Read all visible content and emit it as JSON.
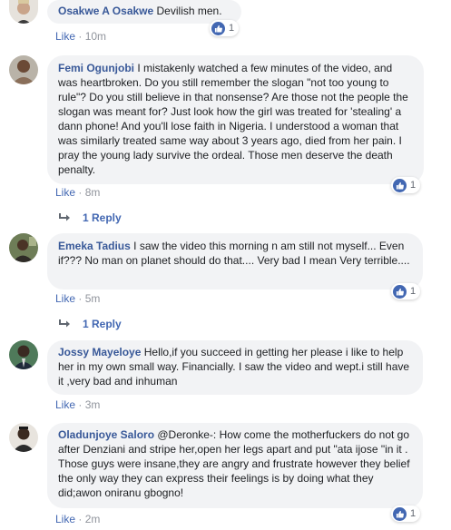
{
  "icons": {
    "like": "thumbs-up-icon",
    "reply": "reply-arrow-icon"
  },
  "colors": {
    "author": "#385898",
    "link": "#4267b2",
    "bubble": "#f2f3f5",
    "meta": "#90949c"
  },
  "comments": [
    {
      "author": "Osakwe A Osakwe",
      "text": "Devilish men.",
      "like_label": "Like",
      "sep": "·",
      "time": "10m",
      "reaction_count": "1"
    },
    {
      "author": "Femi Ogunjobi",
      "text": "I mistakenly watched a few minutes of the video, and was heartbroken. Do you still remember the slogan \"not too young to rule\"? Do you still believe in that nonsense? Are those not the people the slogan was meant for? Just look how the girl was treated for 'stealing' a dann phone! And you'll lose faith in Nigeria. I understood a woman that was similarly treated same way about 3 years ago, died from her pain. I pray the young lady survive the ordeal. Those men deserve the death penalty.",
      "like_label": "Like",
      "sep": "·",
      "time": "8m",
      "reaction_count": "1",
      "replies_label": "1 Reply"
    },
    {
      "author": "Emeka Tadius",
      "text": "I saw the video this morning n am still not myself... Even if??? No man on planet should do that.... Very bad I mean Very terrible....",
      "like_label": "Like",
      "sep": "·",
      "time": "5m",
      "reaction_count": "1",
      "replies_label": "1 Reply"
    },
    {
      "author": "Jossy Mayeloye",
      "text": "Hello,if you succeed in getting her please i like to help her in my own small way. Financially. I saw the video and wept.i still have it ,very bad and inhuman",
      "like_label": "Like",
      "sep": "·",
      "time": "3m"
    },
    {
      "author": "Oladunjoye Saloro",
      "text": "@Deronke-: How come the motherfuckers do not go after Denziani and stripe her,open her legs apart and put \"ata ijose \"in it . Those guys were insane,they are angry and frustrate however they belief the only way they can express their feelings is by doing what they did;awon oniranu gbogno!",
      "like_label": "Like",
      "sep": "·",
      "time": "2m",
      "reaction_count": "1"
    }
  ]
}
